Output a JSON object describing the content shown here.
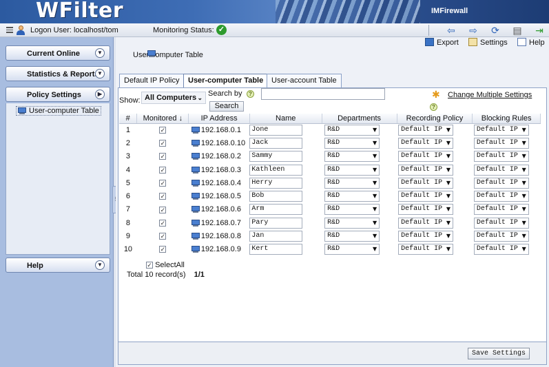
{
  "banner": {
    "logo": "WFilter",
    "product": "IMFirewall"
  },
  "topbar": {
    "logon": "Logon User: localhost/tom",
    "monitoring": "Monitoring Status:"
  },
  "sidebar": {
    "panels": [
      "Current Online",
      "Statistics & Reports",
      "Policy Settings",
      "Help"
    ],
    "policy_item": "User-computer Table"
  },
  "actions": {
    "export": "Export",
    "settings": "Settings",
    "help": "Help"
  },
  "page_title": "User-computer Table",
  "tabs": [
    "Default IP Policy",
    "User-computer Table",
    "User-account Table"
  ],
  "filter": {
    "show_label": "Show:",
    "show_value": "All Computers",
    "search_by": "Search by",
    "search_button": "Search",
    "change_multiple": "Change Multiple Settings"
  },
  "table": {
    "headers": [
      "#",
      "Monitored ↓",
      "IP Address",
      "Name",
      "Departments",
      "Recording Policy",
      "Blocking Rules"
    ],
    "rows": [
      {
        "num": "1",
        "ip": "192.168.0.1",
        "name": "Jone",
        "dept": "R&D",
        "rec": "Default IP",
        "blk": "Default IP"
      },
      {
        "num": "2",
        "ip": "192.168.0.10",
        "name": "Jack",
        "dept": "R&D",
        "rec": "Default IP",
        "blk": "Default IP"
      },
      {
        "num": "3",
        "ip": "192.168.0.2",
        "name": "Sammy",
        "dept": "R&D",
        "rec": "Default IP",
        "blk": "Default IP"
      },
      {
        "num": "4",
        "ip": "192.168.0.3",
        "name": "Kathleen",
        "dept": "R&D",
        "rec": "Default IP",
        "blk": "Default IP"
      },
      {
        "num": "5",
        "ip": "192.168.0.4",
        "name": "Herry",
        "dept": "R&D",
        "rec": "Default IP",
        "blk": "Default IP"
      },
      {
        "num": "6",
        "ip": "192.168.0.5",
        "name": "Bob",
        "dept": "R&D",
        "rec": "Default IP",
        "blk": "Default IP"
      },
      {
        "num": "7",
        "ip": "192.168.0.6",
        "name": "Arm",
        "dept": "R&D",
        "rec": "Default IP",
        "blk": "Default IP"
      },
      {
        "num": "8",
        "ip": "192.168.0.7",
        "name": "Pary",
        "dept": "R&D",
        "rec": "Default IP",
        "blk": "Default IP"
      },
      {
        "num": "9",
        "ip": "192.168.0.8",
        "name": "Jan",
        "dept": "R&D",
        "rec": "Default IP",
        "blk": "Default IP"
      },
      {
        "num": "10",
        "ip": "192.168.0.9",
        "name": "Kert",
        "dept": "R&D",
        "rec": "Default IP",
        "blk": "Default IP"
      }
    ]
  },
  "select_all": "SelectAll",
  "total": {
    "records": "Total 10 record(s)",
    "pages": "1/1"
  },
  "save_button": "Save Settings"
}
